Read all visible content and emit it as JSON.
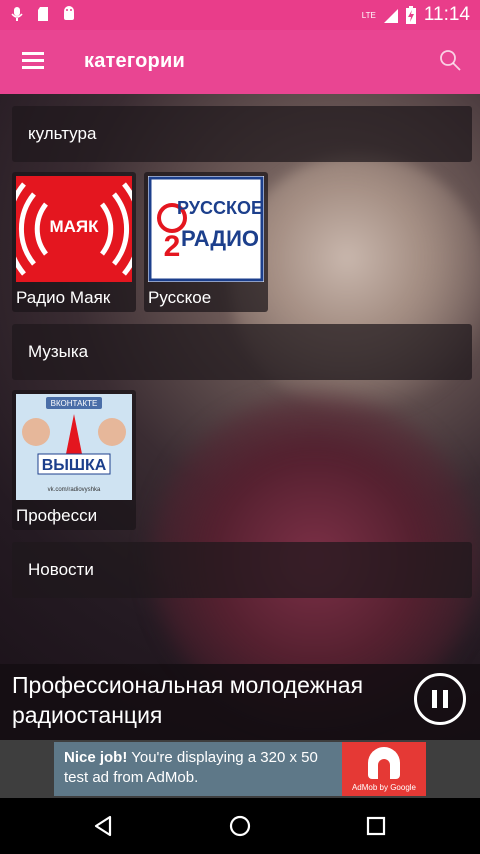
{
  "status_bar": {
    "time": "11:14",
    "network": "LTE",
    "icons_left": [
      "mic-icon",
      "sd-card-icon",
      "android-icon"
    ],
    "icons_right": [
      "lte-icon",
      "signal-icon",
      "battery-icon"
    ]
  },
  "toolbar": {
    "title": "категории",
    "menu_icon": "hamburger-menu-icon",
    "search_icon": "search-icon",
    "color": "#e94592"
  },
  "categories": [
    {
      "label": "культура",
      "stations": [
        {
          "name": "Радио Маяк",
          "logo_text": "МАЯК"
        },
        {
          "name": "Русское",
          "logo_text": "РУССКОЕ РАДИО"
        }
      ]
    },
    {
      "label": "Музыка",
      "stations": [
        {
          "name": "Професси",
          "logo_text": "ВКОНТАКТЕ РАДИО ВЫШКА",
          "logo_url_text": "vk.com/radiovyshka"
        }
      ]
    },
    {
      "label": "Новости",
      "stations": []
    }
  ],
  "now_playing": {
    "text": "Профессиональная молодежная радиостанция",
    "control": "pause"
  },
  "ad": {
    "headline": "Nice job!",
    "body": " You're displaying a 320 x 50 test ad from AdMob.",
    "attribution": "AdMob by Google"
  },
  "nav_bar": {
    "icons": [
      "back-icon",
      "home-icon",
      "recent-apps-icon"
    ]
  }
}
